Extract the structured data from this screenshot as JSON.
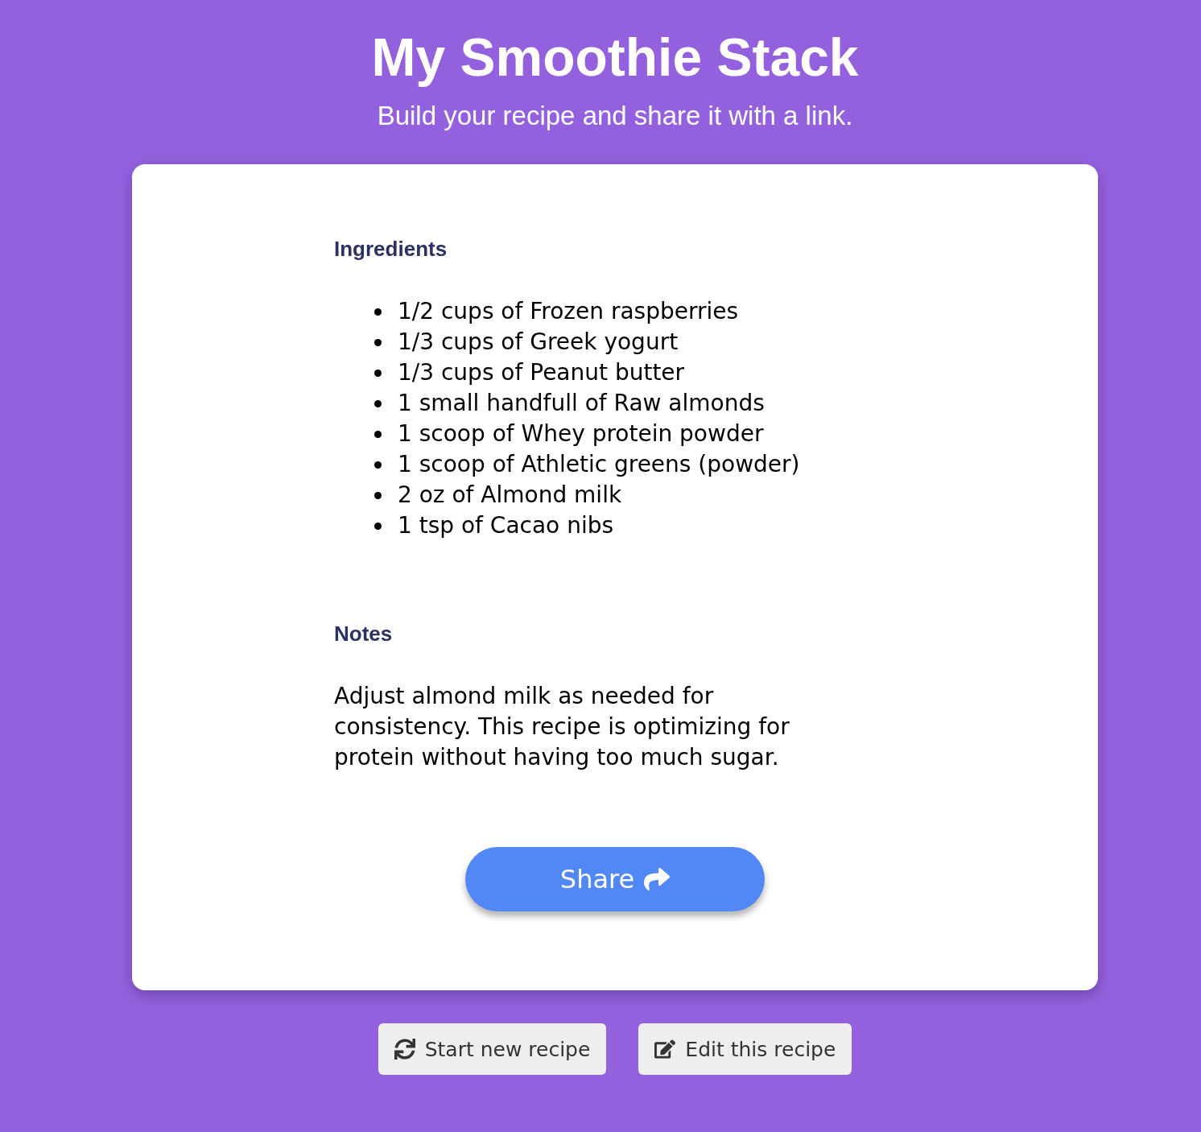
{
  "header": {
    "title": "My Smoothie Stack",
    "subtitle": "Build your recipe and share it with a link."
  },
  "recipe": {
    "ingredients_heading": "Ingredients",
    "ingredients": [
      "1/2 cups of Frozen raspberries",
      "1/3 cups of Greek yogurt",
      "1/3 cups of Peanut butter",
      "1 small handfull of Raw almonds",
      "1 scoop of Whey protein powder",
      "1 scoop of Athletic greens (powder)",
      "2 oz of Almond milk",
      "1 tsp of Cacao nibs"
    ],
    "notes_heading": "Notes",
    "notes": "Adjust almond milk as needed for consistency. This recipe is optimizing for protein without having too much sugar.",
    "share_button": "Share"
  },
  "actions": [
    {
      "label": "Start new recipe",
      "kind": "restart"
    },
    {
      "label": "Edit this recipe",
      "kind": "edit"
    }
  ]
}
